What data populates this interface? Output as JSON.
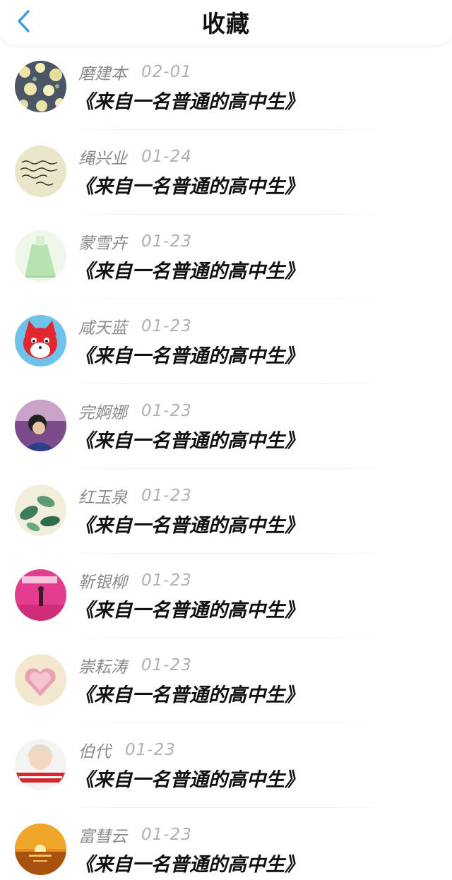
{
  "header": {
    "title": "收藏",
    "back_icon": "chevron-left-icon",
    "accent": "#2f9be6"
  },
  "items": [
    {
      "name": "磨建本",
      "date": "02-01",
      "title": "《来自一名普通的高中生》",
      "avatar": "floral-pattern"
    },
    {
      "name": "绳兴业",
      "date": "01-24",
      "title": "《来自一名普通的高中生》",
      "avatar": "handwriting"
    },
    {
      "name": "蒙雪卉",
      "date": "01-23",
      "title": "《来自一名普通的高中生》",
      "avatar": "green-dress"
    },
    {
      "name": "咸天蓝",
      "date": "01-23",
      "title": "《来自一名普通的高中生》",
      "avatar": "red-fox-cartoon"
    },
    {
      "name": "完婀娜",
      "date": "01-23",
      "title": "《来自一名普通的高中生》",
      "avatar": "portrait-dark"
    },
    {
      "name": "红玉泉",
      "date": "01-23",
      "title": "《来自一名普通的高中生》",
      "avatar": "leaves"
    },
    {
      "name": "靳银柳",
      "date": "01-23",
      "title": "《来自一名普通的高中生》",
      "avatar": "pink-stage"
    },
    {
      "name": "崇耘涛",
      "date": "01-23",
      "title": "《来自一名普通的高中生》",
      "avatar": "pink-heart"
    },
    {
      "name": "伯代",
      "date": "01-23",
      "title": "《来自一名普通的高中生》",
      "avatar": "girl-banner"
    },
    {
      "name": "富彗云",
      "date": "01-23",
      "title": "《来自一名普通的高中生》",
      "avatar": "sunset"
    }
  ]
}
